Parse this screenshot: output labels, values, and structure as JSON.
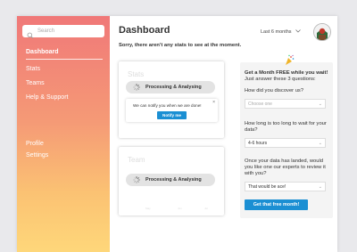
{
  "sidebar": {
    "search_placeholder": "Search",
    "items": [
      {
        "label": "Dashboard"
      },
      {
        "label": "Stats"
      },
      {
        "label": "Teams"
      },
      {
        "label": "Help & Support"
      },
      {
        "label": "Profile"
      },
      {
        "label": "Settings"
      }
    ]
  },
  "header": {
    "title": "Dashboard",
    "period": "Last 6 months"
  },
  "notice": "Sorry, there aren't any stats to see at the moment.",
  "stats_card": {
    "title": "Stats",
    "status": "Processing & Analysing",
    "notify_text": "We can notify you when we are done!",
    "notify_button": "Notify me",
    "close": "×"
  },
  "team_card": {
    "title": "Team",
    "status": "Processing & Analysing",
    "axis_labels": [
      "May",
      "Jun",
      "Jul"
    ]
  },
  "promo": {
    "heading": "Get a Month FREE while you wait!",
    "subheading": "Just answer these 3 questions:",
    "q1": "How did you discover us?",
    "q1_placeholder": "Choose one",
    "q2": "How long is too long to wait for your data?",
    "q2_value": "4-6 hours",
    "q3": "Once your data has landed, would you like one our experts to review it with you?",
    "q3_value": "That would be ace!",
    "cta": "Get that free month!"
  },
  "colors": {
    "accent": "#1b8fd3",
    "gradient_top": "#f07878",
    "gradient_bottom": "#fed77a"
  }
}
